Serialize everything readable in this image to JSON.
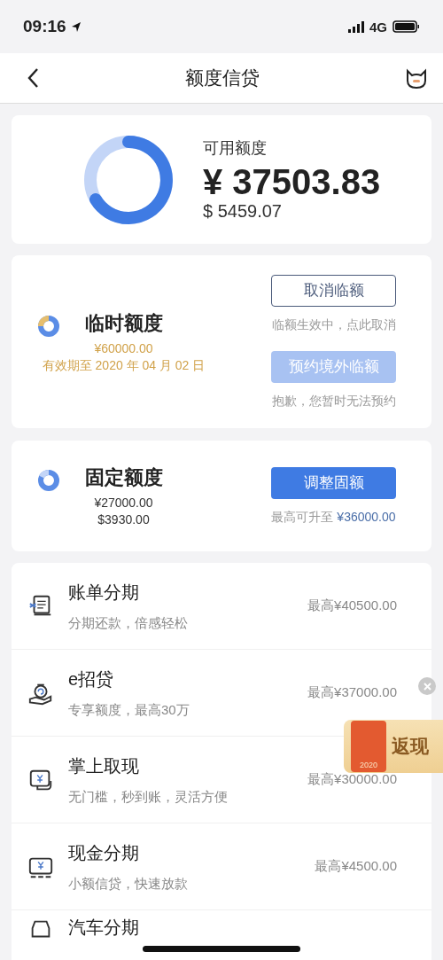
{
  "status_bar": {
    "time": "09:16",
    "network": "4G"
  },
  "nav": {
    "title": "额度信贷"
  },
  "available": {
    "label": "可用额度",
    "amount_cny": "¥ 37503.83",
    "amount_usd": "$ 5459.07"
  },
  "quotas": [
    {
      "kind": "temporary",
      "title": "临时额度",
      "lines": [
        "¥60000.00",
        "有效期至 2020 年 04 月 02 日"
      ],
      "actions": [
        {
          "kind": "outline",
          "label": "取消临额",
          "disabled": false,
          "note": "临额生效中，点此取消"
        },
        {
          "kind": "primary",
          "label": "预约境外临额",
          "disabled": true,
          "note": "抱歉，您暂时无法预约"
        }
      ]
    },
    {
      "kind": "fixed",
      "title": "固定额度",
      "lines": [
        "¥27000.00",
        "$3930.00"
      ],
      "actions": [
        {
          "kind": "primary",
          "label": "调整固额",
          "disabled": false,
          "note": "最高可升至 ",
          "note_amount": "¥36000.00"
        }
      ]
    }
  ],
  "products": [
    {
      "kind": "bill",
      "title": "账单分期",
      "subtitle": "分期还款，倍感轻松",
      "limit": "最高¥40500.00"
    },
    {
      "kind": "loan",
      "title": "e招贷",
      "subtitle": "专享额度，最高30万",
      "limit": "最高¥37000.00"
    },
    {
      "kind": "cash",
      "title": "掌上取现",
      "subtitle": "无门槛，秒到账，灵活方便",
      "limit": "最高¥30000.00"
    },
    {
      "kind": "installment",
      "title": "现金分期",
      "subtitle": "小额信贷，快速放款",
      "limit": "最高¥4500.00"
    },
    {
      "kind": "car",
      "title": "汽车分期"
    }
  ],
  "promo": {
    "label": "返现",
    "year": "2020"
  }
}
